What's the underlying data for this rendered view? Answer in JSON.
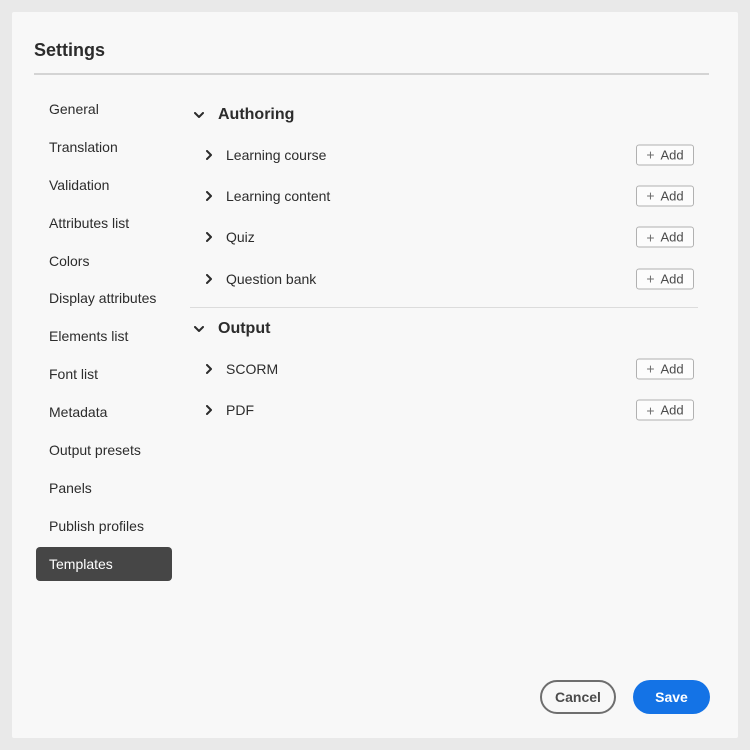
{
  "dialog": {
    "title": "Settings"
  },
  "sidebar": {
    "items": [
      {
        "label": "General",
        "selected": false
      },
      {
        "label": "Translation",
        "selected": false
      },
      {
        "label": "Validation",
        "selected": false
      },
      {
        "label": "Attributes list",
        "selected": false
      },
      {
        "label": "Colors",
        "selected": false
      },
      {
        "label": "Display attributes",
        "selected": false
      },
      {
        "label": "Elements list",
        "selected": false
      },
      {
        "label": "Font list",
        "selected": false
      },
      {
        "label": "Metadata",
        "selected": false
      },
      {
        "label": "Output presets",
        "selected": false
      },
      {
        "label": "Panels",
        "selected": false
      },
      {
        "label": "Publish profiles",
        "selected": false
      },
      {
        "label": "Templates",
        "selected": true
      }
    ]
  },
  "sections": [
    {
      "title": "Authoring",
      "expanded": true,
      "rows": [
        {
          "label": "Learning course",
          "add_label": "Add"
        },
        {
          "label": "Learning content",
          "add_label": "Add"
        },
        {
          "label": "Quiz",
          "add_label": "Add"
        },
        {
          "label": "Question bank",
          "add_label": "Add"
        }
      ]
    },
    {
      "title": "Output",
      "expanded": true,
      "rows": [
        {
          "label": "SCORM",
          "add_label": "Add"
        },
        {
          "label": "PDF",
          "add_label": "Add"
        }
      ]
    }
  ],
  "footer": {
    "cancel_label": "Cancel",
    "save_label": "Save"
  },
  "colors": {
    "accent": "#1473e6",
    "selected_bg": "#464646",
    "background": "#f8f8f8"
  }
}
